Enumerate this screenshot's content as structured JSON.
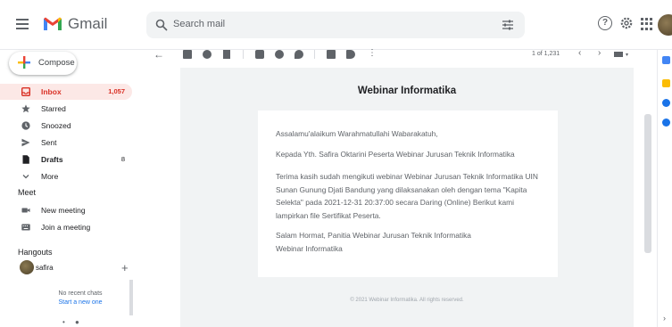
{
  "app": {
    "name": "Gmail"
  },
  "search": {
    "placeholder": "Search mail"
  },
  "compose": {
    "label": "Compose"
  },
  "sidebar": {
    "items": [
      {
        "label": "Inbox",
        "count": "1,057"
      },
      {
        "label": "Starred",
        "count": ""
      },
      {
        "label": "Snoozed",
        "count": ""
      },
      {
        "label": "Sent",
        "count": ""
      },
      {
        "label": "Drafts",
        "count": "8"
      },
      {
        "label": "More",
        "count": ""
      }
    ],
    "meet": {
      "title": "Meet",
      "items": [
        {
          "label": "New meeting"
        },
        {
          "label": "Join a meeting"
        }
      ]
    },
    "hangouts": {
      "title": "Hangouts",
      "user": "safira",
      "no_chats": "No recent chats",
      "start_chat": "Start a new one"
    }
  },
  "toolbar": {
    "pagination": "1 of 1,231",
    "icons": [
      "back-icon",
      "archive-icon",
      "report-spam-icon",
      "delete-icon",
      "mark-unread-icon",
      "snooze-icon",
      "add-to-tasks-icon",
      "move-to-icon",
      "label-icon",
      "more-icon"
    ]
  },
  "email": {
    "subject": "Webinar Informatika",
    "paragraphs": [
      "Assalamu'alaikum Warahmatullahi Wabarakatuh,",
      "Kepada Yth. Safira Oktarini Peserta Webinar Jurusan Teknik Informatika",
      "Terima kasih sudah mengikuti webinar Webinar Jurusan Teknik Informatika UIN Sunan Gunung Djati Bandung yang dilaksanakan oleh dengan tema \"Kapita Selekta\" pada 2021-12-31 20:37:00 secara Daring (Online) Berikut kami lampirkan file Sertifikat Peserta.",
      "Salam Hormat, Panitia Webinar Jurusan Teknik Informatika Webinar Informatika"
    ],
    "footer": "© 2021 Webinar Informatika. All rights reserved."
  },
  "colors": {
    "gmail_red": "#EA4335",
    "inbox_active_bg": "#FCE8E6",
    "inbox_active_text": "#D93025",
    "link_blue": "#1A73E8",
    "email_bg": "#F1F3F4"
  }
}
